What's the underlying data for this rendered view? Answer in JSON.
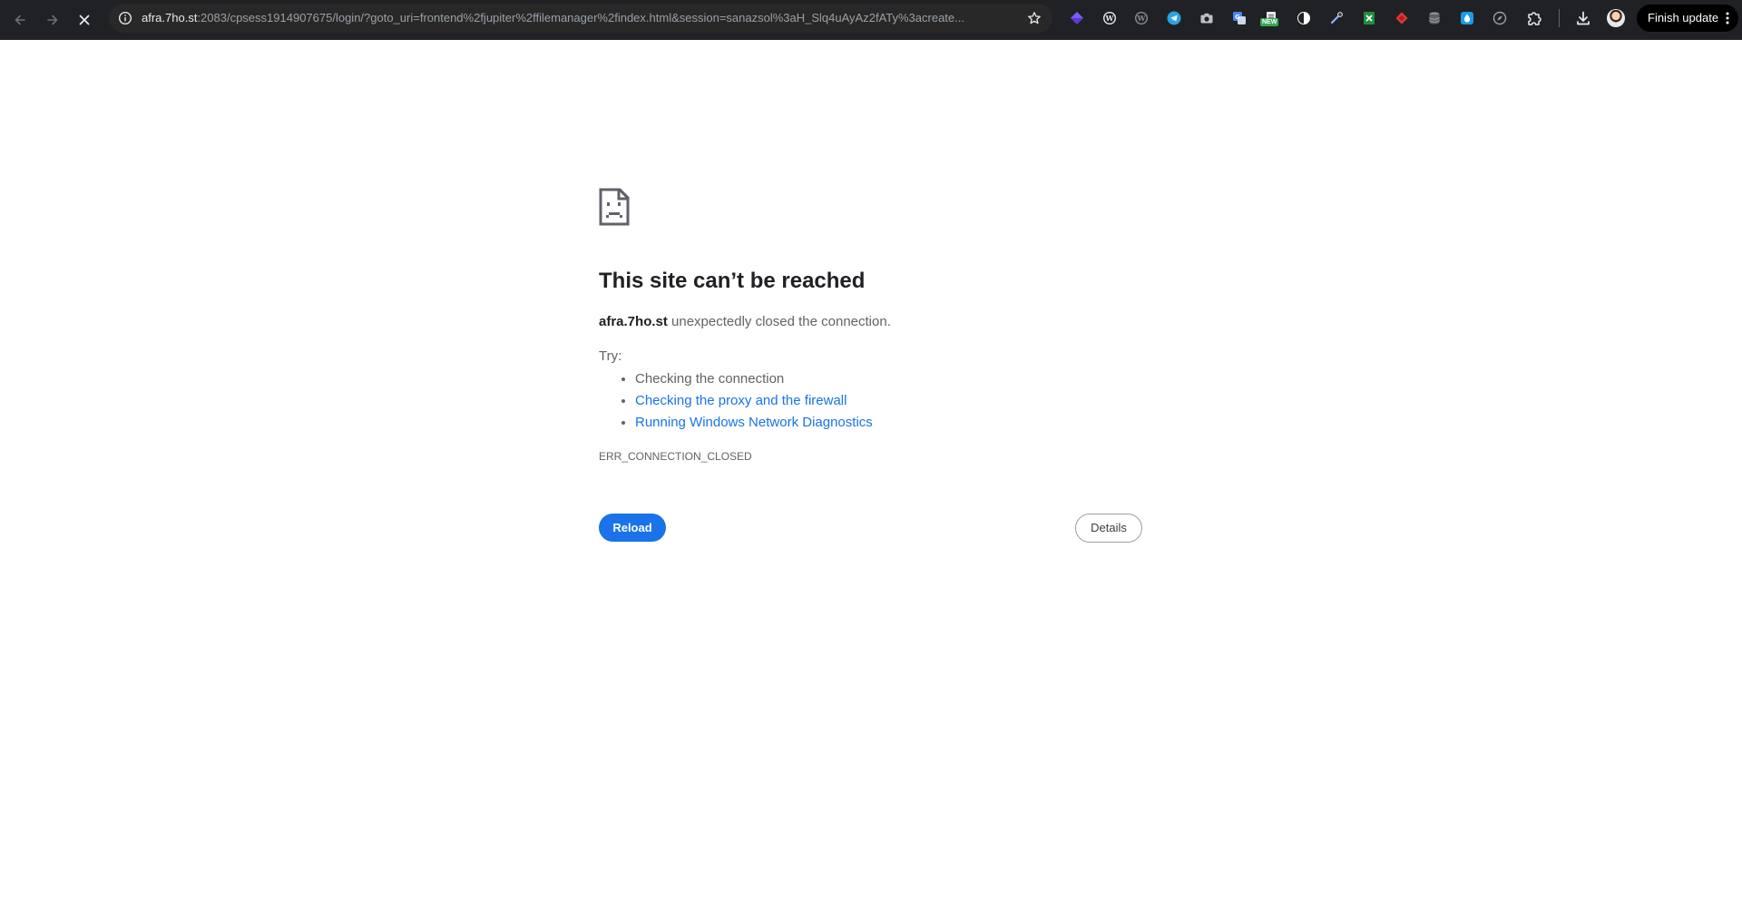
{
  "toolbar": {
    "url_host": "afra.7ho.st",
    "url_rest": ":2083/cpsess1914907675/login/?goto_uri=frontend%2fjupiter%2ffilemanager%2findex.html&session=sanazsol%3aH_Slq4uAyAz2fATy%3acreate...",
    "update_label": "Finish update",
    "extension_badge": "NEW",
    "icons": [
      "back-icon",
      "forward-icon",
      "stop-icon",
      "site-info-icon",
      "bookmark-star-icon",
      "downloads-icon",
      "profile-avatar",
      "more-menu-icon"
    ]
  },
  "error": {
    "title": "This site can’t be reached",
    "host": "afra.7ho.st",
    "summary_rest": " unexpectedly closed the connection.",
    "try_label": "Try:",
    "suggestions": [
      "Checking the connection",
      "Checking the proxy and the firewall",
      "Running Windows Network Diagnostics"
    ],
    "code": "ERR_CONNECTION_CLOSED",
    "reload_label": "Reload",
    "details_label": "Details"
  },
  "colors": {
    "toolbar_bg": "#202124",
    "omnibox_bg": "#282828",
    "link": "#1a73e8",
    "button_primary": "#1a73e8",
    "text_primary": "#202124",
    "text_secondary": "#5f6368"
  }
}
